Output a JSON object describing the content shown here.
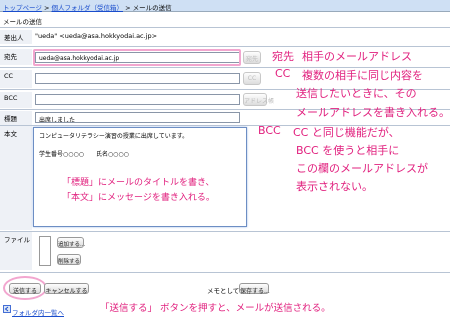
{
  "breadcrumb": {
    "items": [
      "トップページ",
      "個人フォルダ（受信箱）",
      "メールの送信"
    ],
    "separator": ">"
  },
  "page_title": "メールの送信",
  "form": {
    "from_label": "差出人",
    "from_value": "\"ueda\" <ueda@asa.hokkyodai.ac.jp>",
    "to_label": "宛先",
    "to_value": "ueda@asa.hokkyodai.ac.jp",
    "cc_label": "CC",
    "cc_value": "",
    "bcc_label": "BCC",
    "bcc_value": "",
    "subject_label": "標題",
    "subject_value": "出席しました",
    "body_label": "本文",
    "body_line1": "コンピュータリテラシー演習の授業に出席しています。",
    "body_line2": "学生番号○○○○　　氏名○○○○",
    "file_label": "ファイル"
  },
  "buttons": {
    "to_address": "宛先",
    "cc_address": "CC",
    "bcc_address": "アドレス帳",
    "attach_add": "追加する...",
    "attach_delete": "削除する",
    "send": "送信する",
    "cancel": "キャンセルする",
    "save_label": "メモとして",
    "save": "保存する..."
  },
  "annotations": {
    "to_term": "宛先",
    "to_desc": "相手のメールアドレス",
    "cc_term": "CC",
    "cc_desc1": "複数の相手に同じ内容を",
    "cc_desc2": "送信したいときに、その",
    "cc_desc3": "メールアドレスを書き入れる。",
    "bcc_term": "BCC",
    "bcc_desc1": "CC と同じ機能だが、",
    "bcc_desc2": "BCC を使うと相手に",
    "bcc_desc3": "この欄のメールアドレスが",
    "bcc_desc4": "表示されない。",
    "body_note1": "「標題」にメールのタイトルを書き、",
    "body_note2": "「本文」にメッセージを書き入れる。",
    "send_note": "「送信する」 ボタンを押すと、メールが送信される。"
  },
  "footer": {
    "back_link": "フォルダ内一覧へ"
  },
  "colors": {
    "annotation": "#e1207e",
    "highlight": "#f2a6cf",
    "breadcrumb_bg": "#cfe0f4",
    "link": "#1a4dcc"
  }
}
